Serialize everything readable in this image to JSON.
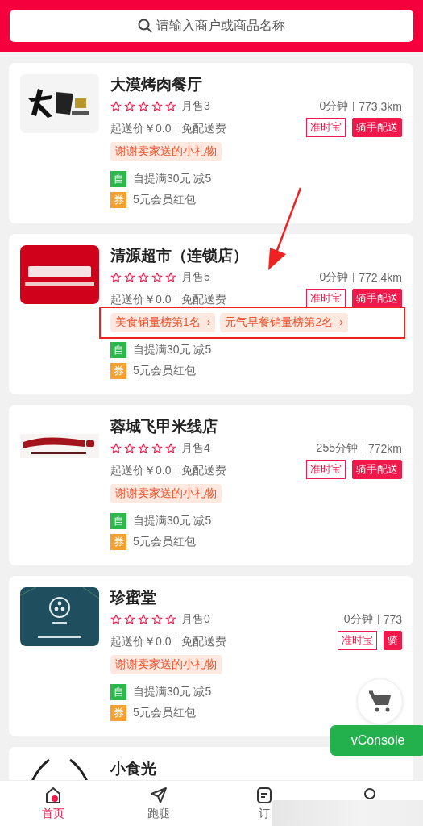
{
  "search": {
    "placeholder": "请输入商户或商品名称"
  },
  "stores": [
    {
      "name": "大漠烤肉餐厅",
      "stars": 0,
      "sales": "月售3",
      "eta": "0分钟",
      "distance": "773.3km",
      "min_order": "起送价￥0.0",
      "delivery_fee": "免配送费",
      "tags": [
        {
          "kind": "outline",
          "text": "准时宝"
        },
        {
          "kind": "filled",
          "text": "骑手配送"
        }
      ],
      "badges": [
        {
          "kind": "gift",
          "text": "谢谢卖家送的小礼物"
        }
      ],
      "promos": [
        {
          "kind": "pickup",
          "icon": "自",
          "text": "自提满30元 减5"
        },
        {
          "kind": "coupon",
          "icon": "券",
          "text": "5元会员红包"
        }
      ],
      "annotated": false
    },
    {
      "name": "清源超市（连锁店）",
      "stars": 0,
      "sales": "月售5",
      "eta": "0分钟",
      "distance": "772.4km",
      "min_order": "起送价￥0.0",
      "delivery_fee": "免配送费",
      "tags": [
        {
          "kind": "outline",
          "text": "准时宝"
        },
        {
          "kind": "filled",
          "text": "骑手配送"
        }
      ],
      "badges": [
        {
          "kind": "rank",
          "text": "美食销量榜第1名",
          "arrow": "›"
        },
        {
          "kind": "rank",
          "text": "元气早餐销量榜第2名",
          "arrow": "›"
        }
      ],
      "promos": [
        {
          "kind": "pickup",
          "icon": "自",
          "text": "自提满30元 减5"
        },
        {
          "kind": "coupon",
          "icon": "券",
          "text": "5元会员红包"
        }
      ],
      "annotated": true
    },
    {
      "name": "蓉城飞甲米线店",
      "stars": 0,
      "sales": "月售4",
      "eta": "255分钟",
      "distance": "772km",
      "min_order": "起送价￥0.0",
      "delivery_fee": "免配送费",
      "tags": [
        {
          "kind": "outline",
          "text": "准时宝"
        },
        {
          "kind": "filled",
          "text": "骑手配送"
        }
      ],
      "badges": [
        {
          "kind": "gift",
          "text": "谢谢卖家送的小礼物"
        }
      ],
      "promos": [
        {
          "kind": "pickup",
          "icon": "自",
          "text": "自提满30元 减5"
        },
        {
          "kind": "coupon",
          "icon": "券",
          "text": "5元会员红包"
        }
      ],
      "annotated": false
    },
    {
      "name": "珍蜜堂",
      "stars": 0,
      "sales": "月售0",
      "eta": "0分钟",
      "distance": "773",
      "min_order": "起送价￥0.0",
      "delivery_fee": "免配送费",
      "tags": [
        {
          "kind": "outline",
          "text": "准时宝"
        },
        {
          "kind": "filled",
          "text": "骑"
        }
      ],
      "badges": [
        {
          "kind": "gift",
          "text": "谢谢卖家送的小礼物"
        }
      ],
      "promos": [
        {
          "kind": "pickup",
          "icon": "自",
          "text": "自提满30元 减5"
        },
        {
          "kind": "coupon",
          "icon": "券",
          "text": "5元会员红包"
        }
      ],
      "annotated": false
    },
    {
      "name": "小食光"
    }
  ],
  "floating": {
    "console": "vConsole"
  },
  "tabs": [
    {
      "label": "首页",
      "selected": true
    },
    {
      "label": "跑腿",
      "selected": false
    },
    {
      "label": "订",
      "selected": false
    },
    {
      "selected": false
    }
  ]
}
